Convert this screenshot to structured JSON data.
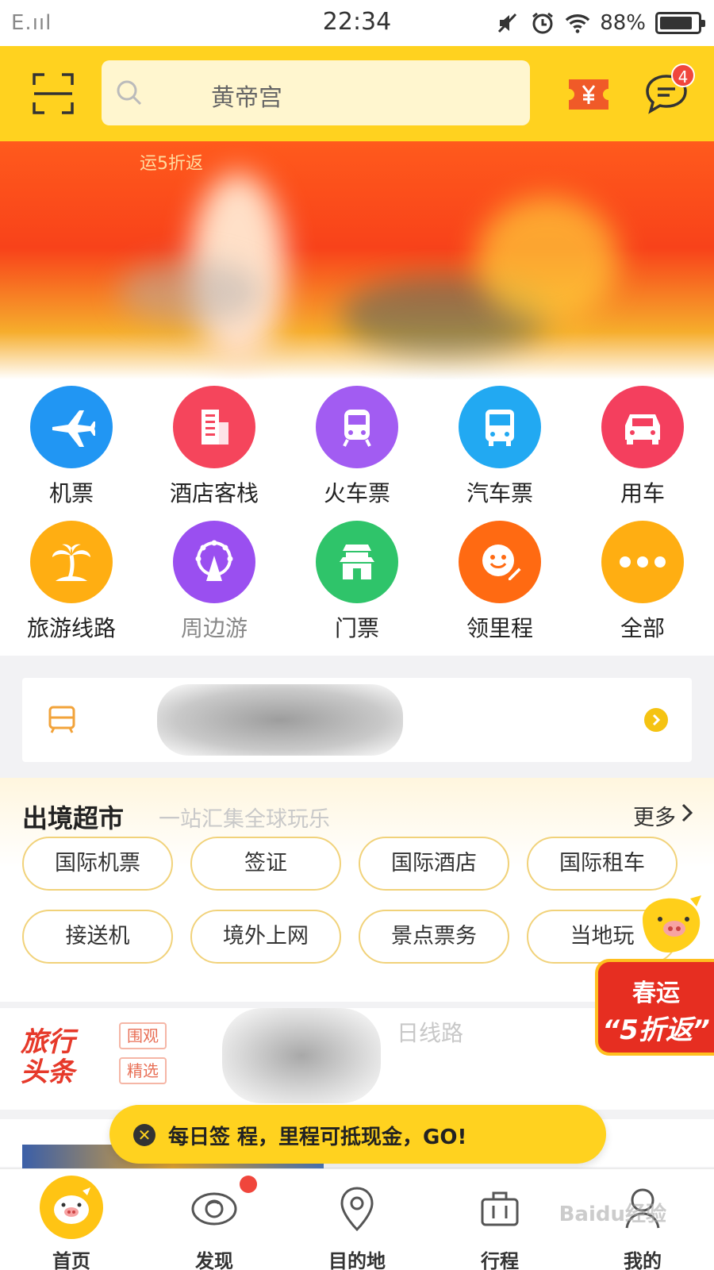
{
  "status_bar": {
    "signal": "E.ııl",
    "time": "22:34",
    "battery": "88%",
    "battery_level": 0.88
  },
  "header": {
    "search_placeholder": "黄帝宫",
    "message_badge": "4",
    "accent_color": "#ffd21f"
  },
  "banner": {
    "tag": "运5折返"
  },
  "grid": {
    "items": [
      {
        "label": "机票",
        "icon": "plane-icon",
        "color": "#2196f3"
      },
      {
        "label": "酒店客栈",
        "icon": "hotel-icon",
        "color": "#f5455c"
      },
      {
        "label": "火车票",
        "icon": "train-icon",
        "color": "#a25cf2"
      },
      {
        "label": "汽车票",
        "icon": "bus-icon",
        "color": "#22a9f2"
      },
      {
        "label": "用车",
        "icon": "car-icon",
        "color": "#f43f5e"
      },
      {
        "label": "旅游线路",
        "icon": "palm-tree-icon",
        "color": "#ffae12"
      },
      {
        "label": "周边游",
        "icon": "ferris-wheel-icon",
        "color": "#9a4ff0"
      },
      {
        "label": "门票",
        "icon": "gate-icon",
        "color": "#2fc46a"
      },
      {
        "label": "领里程",
        "icon": "smile-pen-icon",
        "color": "#ff6a12"
      },
      {
        "label": "全部",
        "icon": "more-dots-icon",
        "color": "#ffae12"
      }
    ]
  },
  "abroad": {
    "title": "出境超市",
    "subtitle": "一站汇集全球玩乐",
    "more": "更多",
    "pills": [
      "国际机票",
      "签证",
      "国际酒店",
      "国际租车",
      "接送机",
      "境外上网",
      "景点票务",
      "当地玩"
    ]
  },
  "promo": {
    "line1": "春运",
    "line2": "“5折返”"
  },
  "headline": {
    "logo": "旅行头条",
    "tags": [
      "围观",
      "精选"
    ],
    "text": "日线路"
  },
  "toast": {
    "text": "每日签        程，里程可抵现金，GO!"
  },
  "tabbar": {
    "tabs": [
      {
        "label": "首页",
        "icon": "pig-home-icon"
      },
      {
        "label": "发现",
        "icon": "discover-icon"
      },
      {
        "label": "目的地",
        "icon": "location-pin-icon"
      },
      {
        "label": "行程",
        "icon": "suitcase-icon"
      },
      {
        "label": "我的",
        "icon": "profile-icon"
      }
    ]
  },
  "watermark": "Baidu经验"
}
